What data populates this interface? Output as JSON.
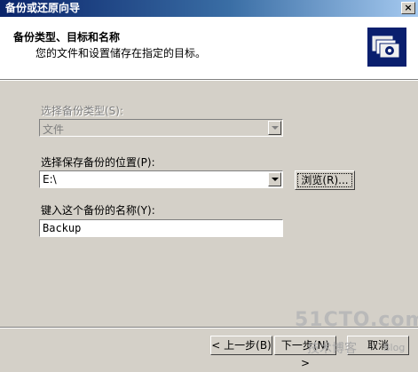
{
  "window": {
    "title": "备份或还原向导",
    "close_glyph": "×"
  },
  "header": {
    "title": "备份类型、目标和名称",
    "subtitle": "您的文件和设置储存在指定的目标。",
    "icon": "backup-wizard-icon"
  },
  "backup_type": {
    "label": "选择备份类型(S):",
    "value": "文件",
    "enabled": false
  },
  "destination": {
    "label": "选择保存备份的位置(P):",
    "value": "E:\\",
    "browse_label": "浏览(R)..."
  },
  "backup_name": {
    "label": "键入这个备份的名称(Y):",
    "value": "Backup"
  },
  "buttons": {
    "back": "< 上一步(B)",
    "next": "下一步(N) >",
    "cancel": "取消"
  },
  "watermark": {
    "main": "51CTO.com",
    "sub": "技术博客",
    "blog": "Blog"
  }
}
